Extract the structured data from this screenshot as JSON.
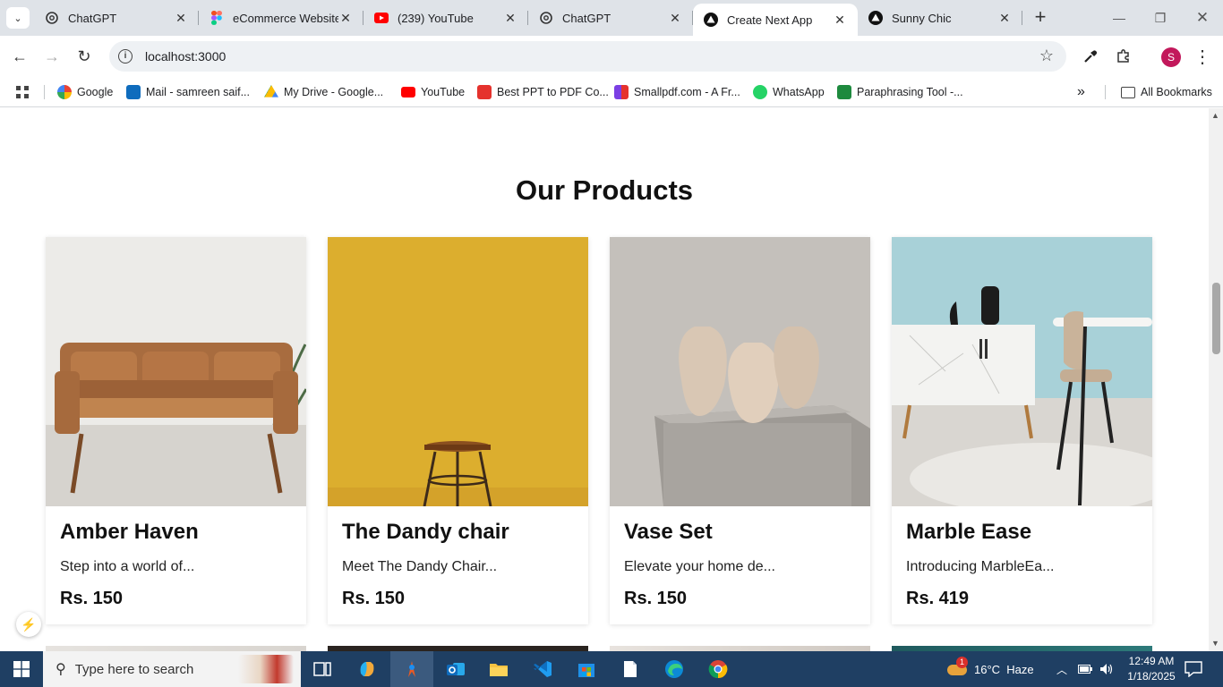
{
  "browser": {
    "tabs": [
      {
        "title": "ChatGPT",
        "icon": "chatgpt-icon"
      },
      {
        "title": "eCommerce Website",
        "icon": "figma-icon"
      },
      {
        "title": "(239) YouTube",
        "icon": "youtube-icon"
      },
      {
        "title": "ChatGPT",
        "icon": "chatgpt-icon"
      },
      {
        "title": "Create Next App",
        "icon": "nextjs-icon",
        "active": true
      },
      {
        "title": "Sunny Chic",
        "icon": "nextjs-icon"
      }
    ],
    "url": "localhost:3000",
    "profile_initial": "S",
    "bookmarks": [
      {
        "label": "Google",
        "icon": "google-icon",
        "color": "#4285f4"
      },
      {
        "label": "Mail - samreen saif...",
        "icon": "outlook-icon",
        "color": "#0f6cbd"
      },
      {
        "label": "My Drive - Google...",
        "icon": "drive-icon",
        "color": "#fbbc04"
      },
      {
        "label": "YouTube",
        "icon": "youtube-icon",
        "color": "#ff0000"
      },
      {
        "label": "Best PPT to PDF Co...",
        "icon": "ilovepdf-icon",
        "color": "#e5322d"
      },
      {
        "label": "Smallpdf.com - A Fr...",
        "icon": "smallpdf-icon",
        "color": "#7b3fe4"
      },
      {
        "label": "WhatsApp",
        "icon": "whatsapp-icon",
        "color": "#25d366"
      },
      {
        "label": "Paraphrasing Tool -...",
        "icon": "quillbot-icon",
        "color": "#1e8a3e"
      }
    ],
    "all_bookmarks_label": "All Bookmarks"
  },
  "page": {
    "section_title": "Our Products",
    "products": [
      {
        "name": "Amber Haven",
        "description": "Step into a world of...",
        "price": "Rs. 150",
        "image": "sofa-image"
      },
      {
        "name": "The Dandy chair",
        "description": "Meet The Dandy Chair...",
        "price": "Rs. 150",
        "image": "stool-image"
      },
      {
        "name": "Vase Set",
        "description": "Elevate your home de...",
        "price": "Rs. 150",
        "image": "vase-image"
      },
      {
        "name": "Marble Ease",
        "description": "Introducing MarbleEa...",
        "price": "Rs. 419",
        "image": "marble-image"
      }
    ]
  },
  "taskbar": {
    "search_placeholder": "Type here to search",
    "weather": "16°C  Haze",
    "time": "12:49 AM",
    "date": "1/18/2025",
    "notification_count": "1"
  }
}
